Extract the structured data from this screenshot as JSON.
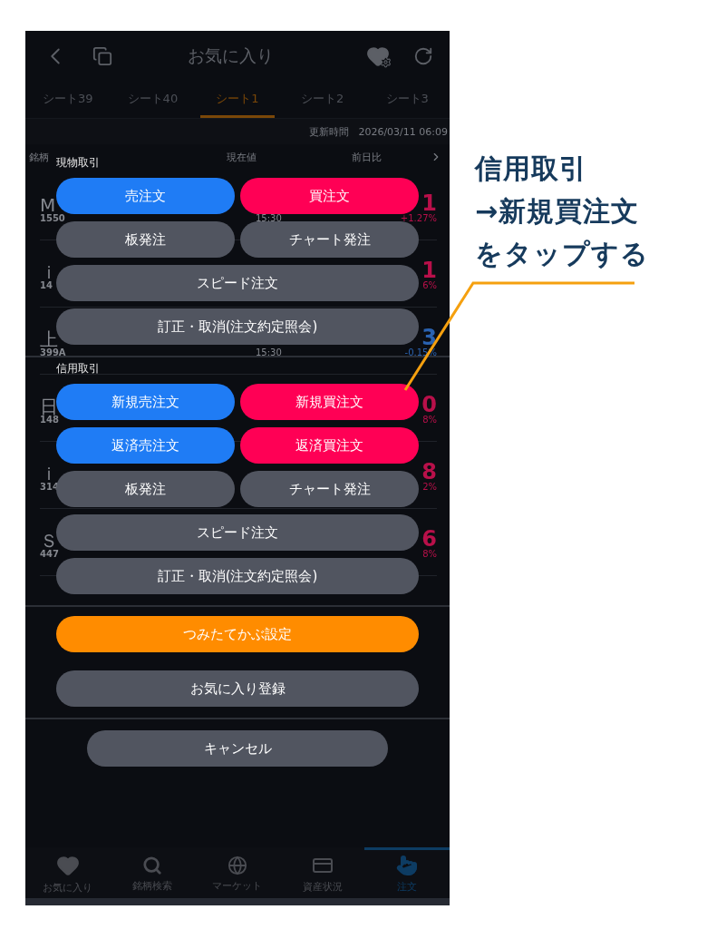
{
  "header": {
    "title": "お気に入り"
  },
  "tabs": [
    {
      "label": "シート39",
      "selected": false
    },
    {
      "label": "シート40",
      "selected": false
    },
    {
      "label": "シート1",
      "selected": true
    },
    {
      "label": "シート2",
      "selected": false
    },
    {
      "label": "シート3",
      "selected": false
    }
  ],
  "update": {
    "label": "更新時間",
    "time": "2026/03/11 06:09"
  },
  "columns": [
    "銘柄",
    "現在値",
    "前日比"
  ],
  "rows": [
    {
      "name": "M",
      "code": "1550",
      "time": "15:30",
      "change": "1",
      "pct": "+1.27%",
      "color": "#b8104a"
    },
    {
      "name": "ｉ",
      "code": "14",
      "change": "1",
      "pct": "6%",
      "color": "#b8104a"
    },
    {
      "name": "上",
      "code": "399A",
      "time": "15:30",
      "change": "3",
      "pct": "-0.15%",
      "color": "#2a62b0"
    },
    {
      "name": "日",
      "code": "148",
      "change": "0",
      "pct": "8%",
      "color": "#b8104a"
    },
    {
      "name": "ｉ",
      "code": "314",
      "change": "8",
      "pct": "2%",
      "color": "#b8104a"
    },
    {
      "name": "Ｓ",
      "code": "447",
      "change": "6",
      "pct": "8%",
      "color": "#b8104a"
    }
  ],
  "sheet": {
    "sections": [
      {
        "title": "現物取引",
        "buttons": [
          {
            "label": "売注文",
            "kind": "sell",
            "wide": false
          },
          {
            "label": "買注文",
            "kind": "buy",
            "wide": false
          },
          {
            "label": "板発注",
            "kind": "neutral",
            "wide": false
          },
          {
            "label": "チャート発注",
            "kind": "neutral",
            "wide": false
          },
          {
            "label": "スピード注文",
            "kind": "neutral",
            "wide": true
          },
          {
            "label": "訂正・取消(注文約定照会)",
            "kind": "neutral",
            "wide": true
          }
        ]
      },
      {
        "title": "信用取引",
        "buttons": [
          {
            "label": "新規売注文",
            "kind": "sell",
            "wide": false
          },
          {
            "label": "新規買注文",
            "kind": "buy",
            "wide": false
          },
          {
            "label": "返済売注文",
            "kind": "sell",
            "wide": false
          },
          {
            "label": "返済買注文",
            "kind": "buy",
            "wide": false
          },
          {
            "label": "板発注",
            "kind": "neutral",
            "wide": false
          },
          {
            "label": "チャート発注",
            "kind": "neutral",
            "wide": false
          },
          {
            "label": "スピード注文",
            "kind": "neutral",
            "wide": true
          },
          {
            "label": "訂正・取消(注文約定照会)",
            "kind": "neutral",
            "wide": true
          }
        ]
      },
      {
        "buttons": [
          {
            "label": "つみたてかぶ設定",
            "kind": "accent",
            "wide": true
          },
          {
            "label": "お気に入り登録",
            "kind": "neutral",
            "wide": true
          }
        ]
      }
    ],
    "cancel": "キャンセル"
  },
  "nav": [
    {
      "label": "お気に入り",
      "selected": false
    },
    {
      "label": "銘柄検索",
      "selected": false
    },
    {
      "label": "マーケット",
      "selected": false
    },
    {
      "label": "資産状況",
      "selected": false
    },
    {
      "label": "注文",
      "selected": true
    }
  ],
  "annotation": {
    "lines": [
      "信用取引",
      "→新規買注文",
      "をタップする"
    ]
  }
}
